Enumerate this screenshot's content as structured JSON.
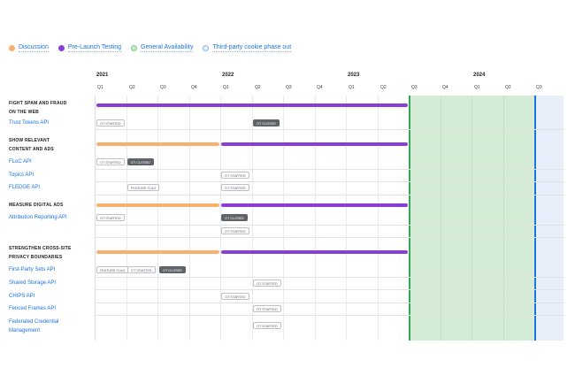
{
  "colors": {
    "discussion": "#f6b26b",
    "pre_launch": "#8a3ed8",
    "general_availability": "#c8e6c9",
    "cookie_phase_out": "#e8effb",
    "link": "#1a73e8"
  },
  "legend": [
    {
      "label": "Discussion",
      "color": "#f6b26b"
    },
    {
      "label": "Pre-Launch Testing",
      "color": "#8a3ed8"
    },
    {
      "label": "General Availability",
      "color": "#c8e6c9"
    },
    {
      "label": "Third-party cookie phase out",
      "color": "#e8effb"
    }
  ],
  "years": [
    "2021",
    "2022",
    "2023",
    "2024"
  ],
  "quarters": [
    "Q1",
    "Q2",
    "Q3",
    "Q4",
    "Q1",
    "Q2",
    "Q3",
    "Q4",
    "Q1",
    "Q2",
    "Q3",
    "Q4",
    "Q1",
    "Q2",
    "Q3"
  ],
  "categories": [
    {
      "line1": "FIGHT SPAM AND FRAUD",
      "line2": "ON THE WEB"
    },
    {
      "line1": "SHOW RELEVANT",
      "line2": "CONTENT AND ADS"
    },
    {
      "line1": "MEASURE DIGITAL ADS",
      "line2": ""
    },
    {
      "line1": "STRENGTHEN CROSS-SITE",
      "line2": "PRIVACY BOUNDARIES"
    }
  ],
  "apis": {
    "trust_tokens": "Trust Tokens API",
    "floc": "FLoC API",
    "topics": "Topics API",
    "fledge": "FLEDGE API",
    "attribution": "Attribution Reporting API",
    "first_party_sets": "First-Party Sets API",
    "shared_storage": "Shared Storage API",
    "chips": "CHIPS API",
    "fenced_frames": "Fenced Frames API",
    "fedcm_line1": "Federated Credential",
    "fedcm_line2": "Management"
  },
  "tags": {
    "ot_started": "OT STARTED",
    "ot_closed": "OT CLOSED",
    "feature_flag": "FEATURE FLAG"
  }
}
